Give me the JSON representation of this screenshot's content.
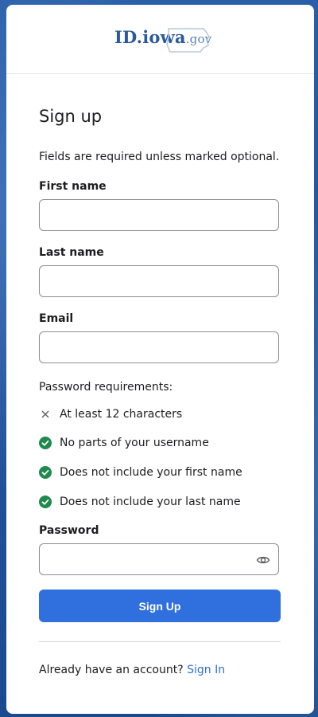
{
  "brand": {
    "logo_main": "ID.iowa",
    "logo_suffix": ".gov"
  },
  "form": {
    "title": "Sign up",
    "required_note": "Fields are required unless marked optional.",
    "fields": {
      "first_name": {
        "label": "First name",
        "value": ""
      },
      "last_name": {
        "label": "Last name",
        "value": ""
      },
      "email": {
        "label": "Email",
        "value": ""
      },
      "password": {
        "label": "Password",
        "value": ""
      }
    },
    "password_requirements": {
      "heading": "Password requirements:",
      "items": [
        {
          "text": "At least 12 characters",
          "status": "unmet",
          "icon": "x-icon"
        },
        {
          "text": "No parts of your username",
          "status": "met",
          "icon": "check-circle-icon"
        },
        {
          "text": "Does not include your first name",
          "status": "met",
          "icon": "check-circle-icon"
        },
        {
          "text": "Does not include your last name",
          "status": "met",
          "icon": "check-circle-icon"
        }
      ]
    },
    "submit_label": "Sign Up",
    "account_prompt": "Already have an account?",
    "sign_in_link": "Sign In"
  },
  "colors": {
    "accent": "#2f6fde",
    "success": "#1f8a4c",
    "background": "#1f4f95"
  }
}
